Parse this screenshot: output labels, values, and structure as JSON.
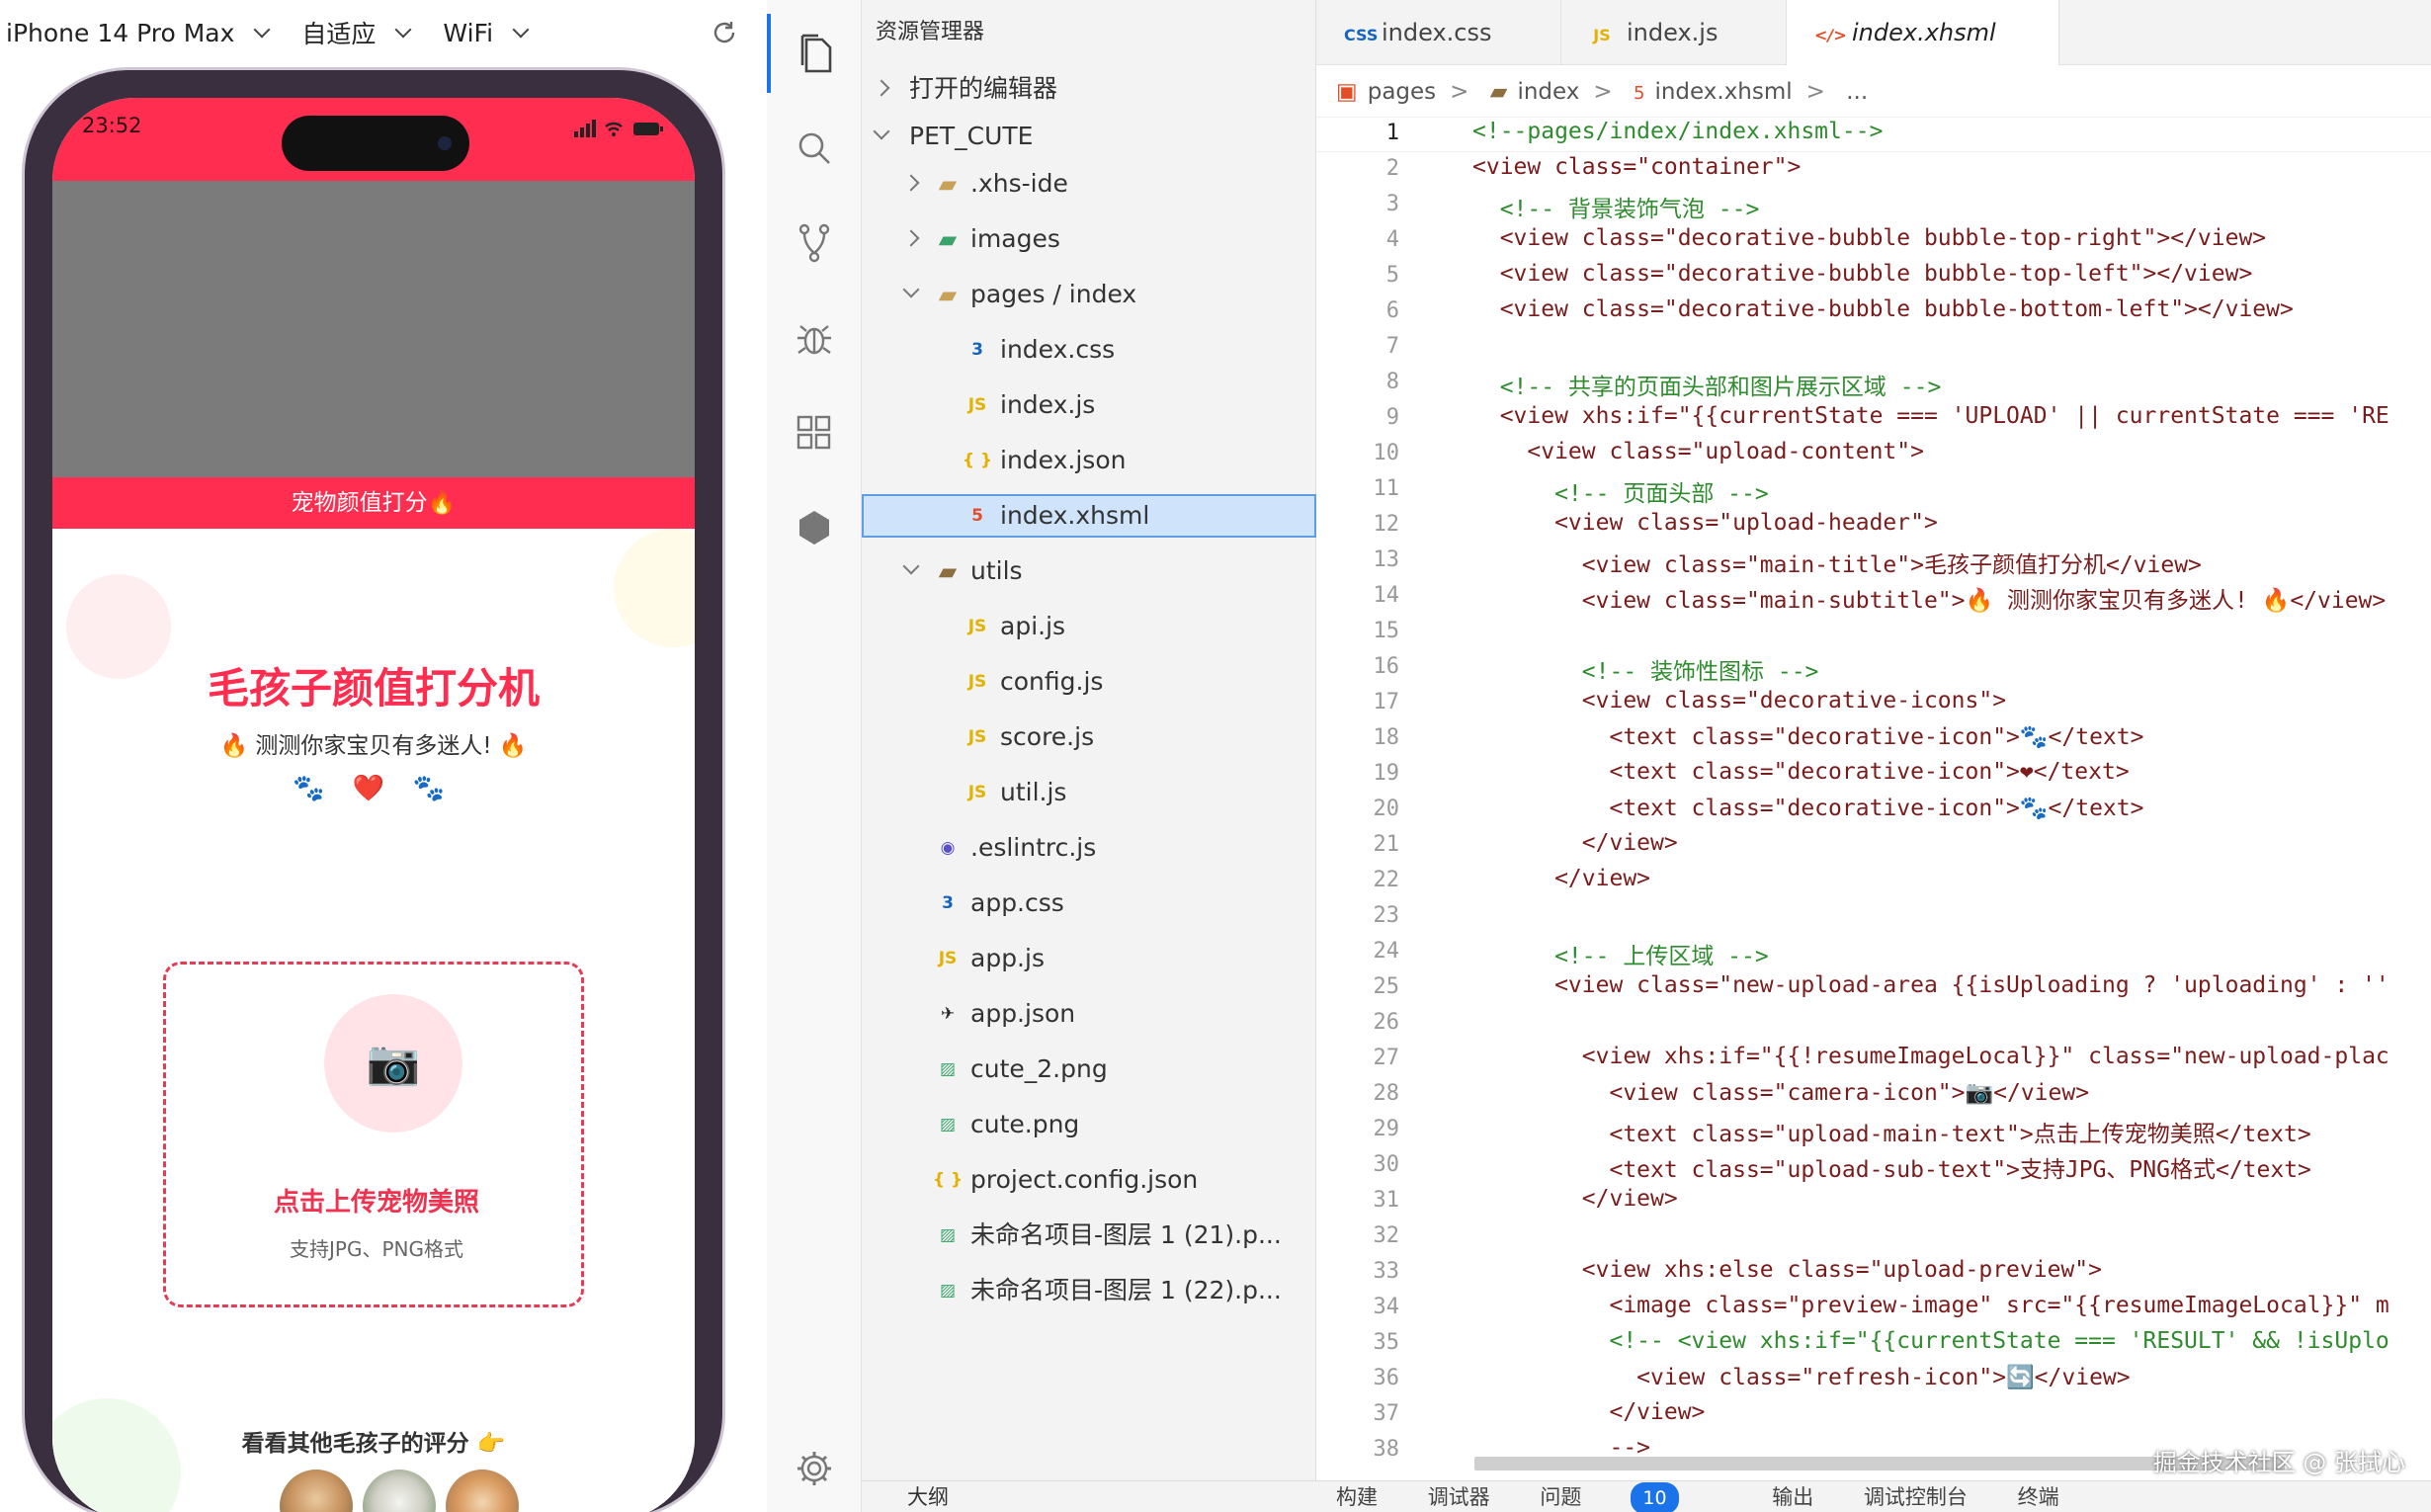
{
  "simulator": {
    "device": "iPhone 14 Pro Max",
    "scale": "自适应",
    "network": "WiFi",
    "status_time": "23:52",
    "status_icons": "▮▮▮ ◠ ▬",
    "nav_title": "宠物颜值打分🔥",
    "main_title": "毛孩子颜值打分机",
    "subtitle": "🔥 测测你家宝贝有多迷人! 🔥",
    "paws": "🐾 ❤️ 🐾",
    "camera_glyph": "📷",
    "upload_main": "点击上传宠物美照",
    "upload_sub": "支持JPG、PNG格式",
    "others_title": "看看其他毛孩子的评分 👉"
  },
  "explorer": {
    "header": "资源管理器",
    "open_editors": "打开的编辑器",
    "root": "PET_CUTE",
    "items": [
      {
        "label": ".xhs-ide",
        "icon": "folder"
      },
      {
        "label": "images",
        "icon": "folder-images"
      },
      {
        "label": "pages / index",
        "icon": "folder-open"
      },
      {
        "label": "index.css",
        "icon": "css"
      },
      {
        "label": "index.js",
        "icon": "js"
      },
      {
        "label": "index.json",
        "icon": "json"
      },
      {
        "label": "index.xhsml",
        "icon": "html"
      },
      {
        "label": "utils",
        "icon": "folder-utils"
      },
      {
        "label": "api.js",
        "icon": "js"
      },
      {
        "label": "config.js",
        "icon": "js"
      },
      {
        "label": "score.js",
        "icon": "js"
      },
      {
        "label": "util.js",
        "icon": "js"
      },
      {
        "label": ".eslintrc.js",
        "icon": "eslint"
      },
      {
        "label": "app.css",
        "icon": "css"
      },
      {
        "label": "app.js",
        "icon": "js"
      },
      {
        "label": "app.json",
        "icon": "app-json"
      },
      {
        "label": "cute_2.png",
        "icon": "image"
      },
      {
        "label": "cute.png",
        "icon": "image"
      },
      {
        "label": "project.config.json",
        "icon": "json"
      },
      {
        "label": "未命名项目-图层 1 (21).p...",
        "icon": "image"
      },
      {
        "label": "未命名项目-图层 1 (22).p...",
        "icon": "image"
      }
    ],
    "outline": "大纲"
  },
  "editor": {
    "tabs": [
      {
        "label": "index.css",
        "icon": "css"
      },
      {
        "label": "index.js",
        "icon": "js"
      },
      {
        "label": "index.xhsml",
        "icon": "html"
      }
    ],
    "breadcrumb": [
      "pages",
      "index",
      "index.xhsml",
      "..."
    ],
    "lines": [
      "<!--pages/index/index.xhsml-->",
      "<view class=\"container\">",
      "  <!-- 背景装饰气泡 -->",
      "  <view class=\"decorative-bubble bubble-top-right\"></view>",
      "  <view class=\"decorative-bubble bubble-top-left\"></view>",
      "  <view class=\"decorative-bubble bubble-bottom-left\"></view>",
      "",
      "  <!-- 共享的页面头部和图片展示区域 -->",
      "  <view xhs:if=\"{{currentState === 'UPLOAD' || currentState === 'RE",
      "    <view class=\"upload-content\">",
      "      <!-- 页面头部 -->",
      "      <view class=\"upload-header\">",
      "        <view class=\"main-title\">毛孩子颜值打分机</view>",
      "        <view class=\"main-subtitle\">🔥 测测你家宝贝有多迷人! 🔥</view>",
      "",
      "        <!-- 装饰性图标 -->",
      "        <view class=\"decorative-icons\">",
      "          <text class=\"decorative-icon\">🐾</text>",
      "          <text class=\"decorative-icon\">❤</text>",
      "          <text class=\"decorative-icon\">🐾</text>",
      "        </view>",
      "      </view>",
      "",
      "      <!-- 上传区域 -->",
      "      <view class=\"new-upload-area {{isUploading ? 'uploading' : ''",
      "",
      "        <view xhs:if=\"{{!resumeImageLocal}}\" class=\"new-upload-plac",
      "          <view class=\"camera-icon\">📷</view>",
      "          <text class=\"upload-main-text\">点击上传宠物美照</text>",
      "          <text class=\"upload-sub-text\">支持JPG、PNG格式</text>",
      "        </view>",
      "",
      "        <view xhs:else class=\"upload-preview\">",
      "          <image class=\"preview-image\" src=\"{{resumeImageLocal}}\" m",
      "          <!-- <view xhs:if=\"{{currentState === 'RESULT' && !isUplo",
      "            <view class=\"refresh-icon\">🔄</view>",
      "          </view>",
      "          -->"
    ],
    "line_numbers": [
      "1",
      "2",
      "3",
      "4",
      "5",
      "6",
      "7",
      "8",
      "9",
      "10",
      "11",
      "12",
      "13",
      "14",
      "15",
      "16",
      "17",
      "18",
      "19",
      "20",
      "21",
      "22",
      "23",
      "24",
      "25",
      "26",
      "27",
      "28",
      "29",
      "30",
      "31",
      "32",
      "33",
      "34",
      "35",
      "36",
      "37",
      "38"
    ]
  },
  "bottom_panel": {
    "tabs": [
      "构建",
      "调试器",
      "问题",
      "输出",
      "调试控制台",
      "终端"
    ],
    "problems_count": "10"
  },
  "watermark": "掘金技术社区 @ 张拭心",
  "colors": {
    "brand": "#ff2d4f",
    "accent": "#1a73e8"
  }
}
